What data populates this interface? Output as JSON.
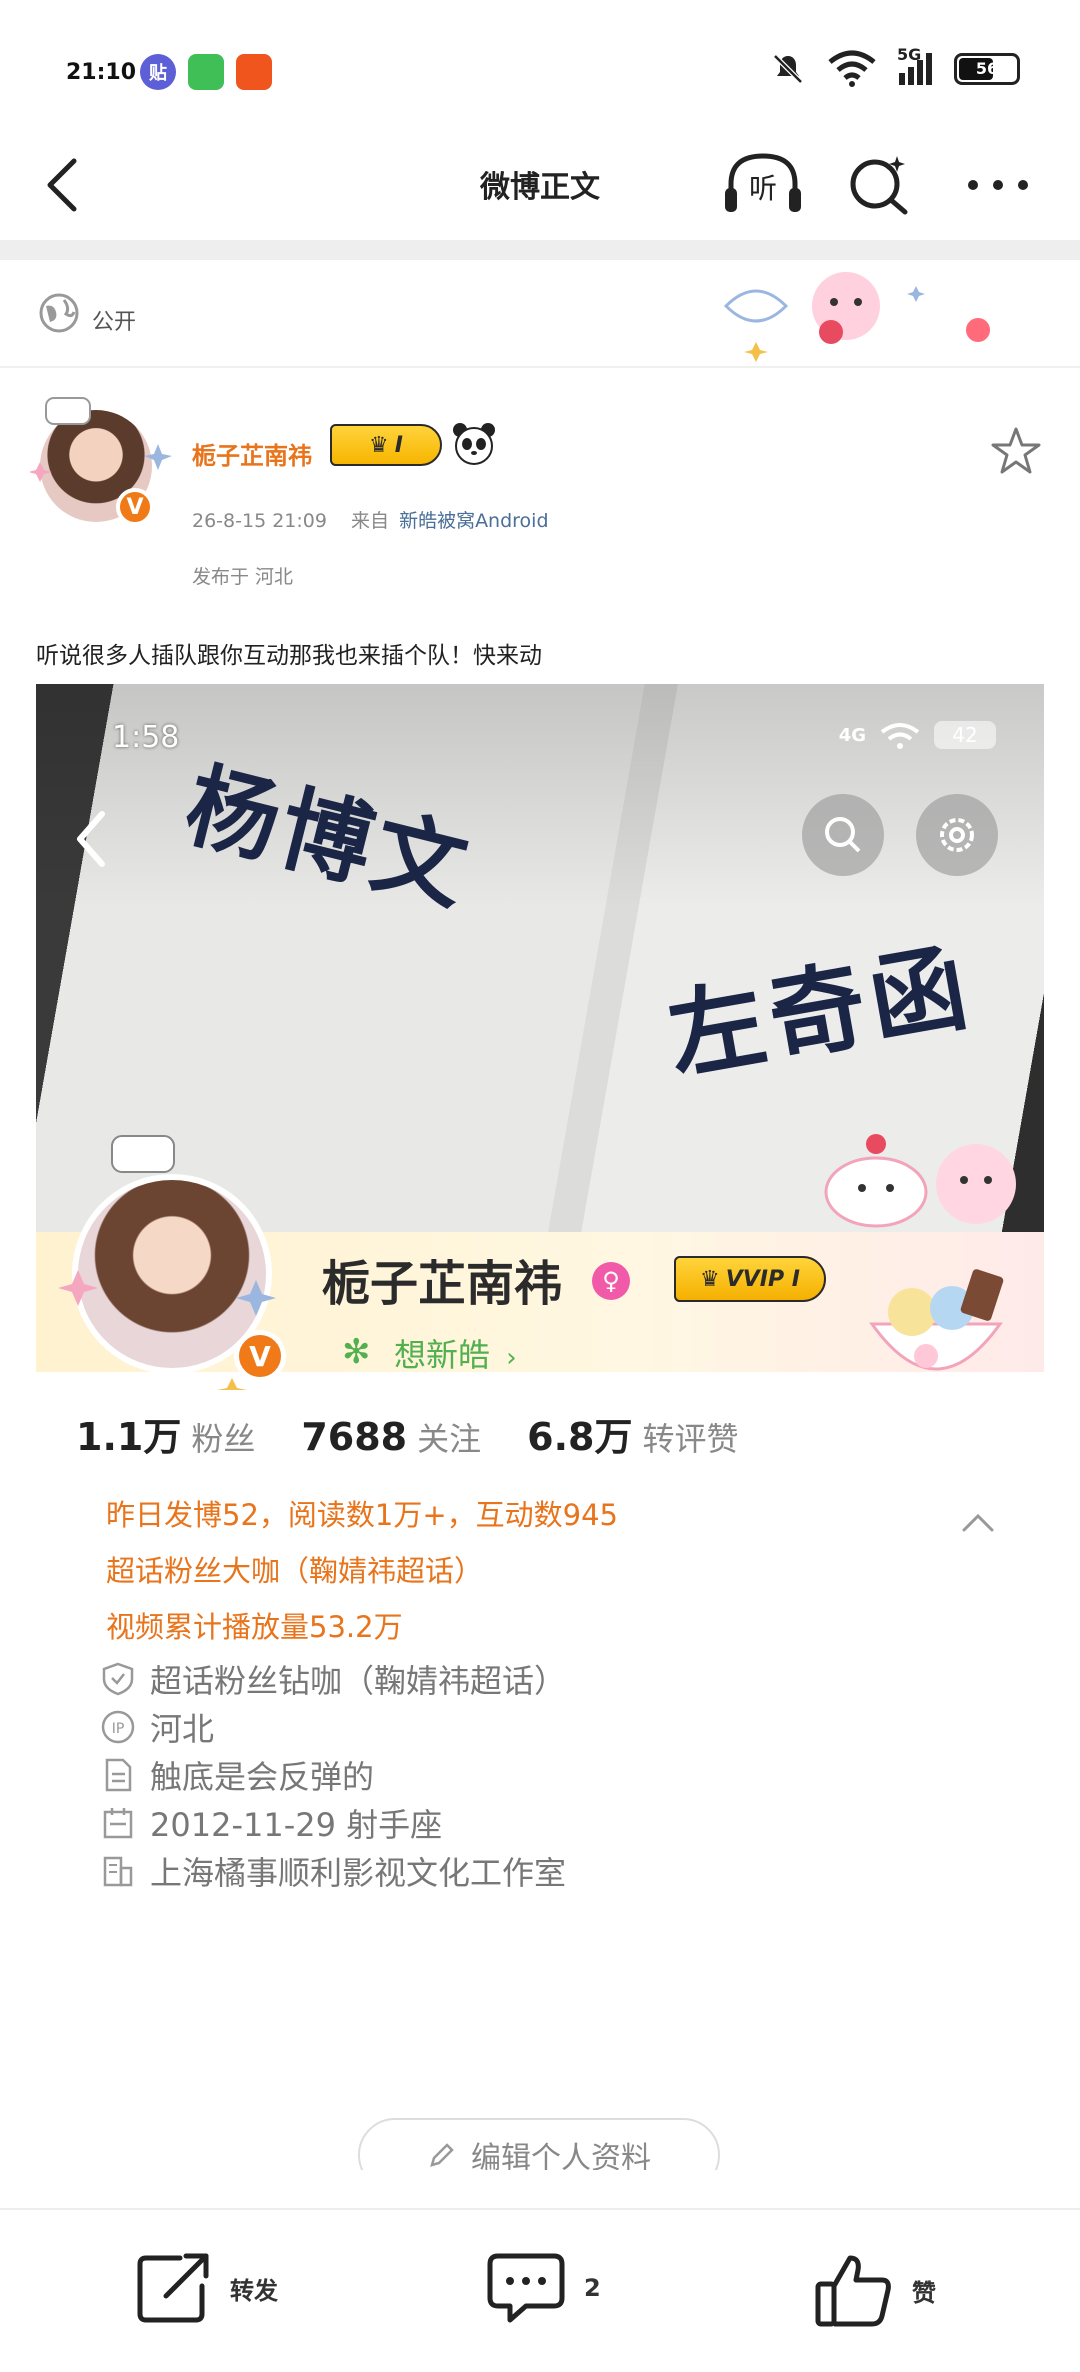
{
  "status_bar": {
    "time": "21:10",
    "apps": [
      "贴",
      "msg",
      "app"
    ],
    "network": "5G",
    "battery": "56"
  },
  "nav": {
    "title": "微博正文",
    "listen_label": "听",
    "icons": [
      "back-icon",
      "listen-icon",
      "search-icon",
      "more-icon"
    ]
  },
  "visibility": {
    "label": "公开"
  },
  "post": {
    "author": "栀子芷南祎",
    "badge": "I",
    "timestamp": "26-8-15 21:09",
    "from_label": "来自",
    "source": "新皓被窝Android",
    "location": "发布于 河北",
    "text": "听说很多人插队跟你互动那我也来插个队！快来动"
  },
  "screenshot": {
    "time": "1:58",
    "network": "4G",
    "battery": "42",
    "shirt_left": "杨博文",
    "shirt_right": "左奇函",
    "profile": {
      "name": "栀子芷南祎",
      "vvip": "VVIP I",
      "follow_text": "想新皓",
      "fans_num": "1.1万",
      "fans_label": "粉丝",
      "following_num": "7688",
      "following_label": "关注",
      "likes_num": "6.8万",
      "likes_label": "转评赞",
      "highlights": [
        "昨日发博52，阅读数1万+，互动数945",
        "超话粉丝大咖（鞠婧祎超话）",
        "视频累计播放量53.2万"
      ],
      "info": [
        {
          "icon": "shield-icon",
          "text": "超话粉丝钻咖（鞠婧祎超话）"
        },
        {
          "icon": "ip-icon",
          "text": "河北"
        },
        {
          "icon": "document-icon",
          "text": "触底是会反弹的"
        },
        {
          "icon": "calendar-icon",
          "text": "2012-11-29 射手座"
        },
        {
          "icon": "building-icon",
          "text": "上海橘事顺利影视文化工作室"
        }
      ],
      "edit_label": "编辑个人资料"
    }
  },
  "actions": {
    "repost_label": "转发",
    "comment_count": "2",
    "like_label": "赞"
  },
  "colors": {
    "accent_orange": "#e8741c",
    "source_blue": "#4a6f98",
    "follow_green": "#52b04f"
  }
}
